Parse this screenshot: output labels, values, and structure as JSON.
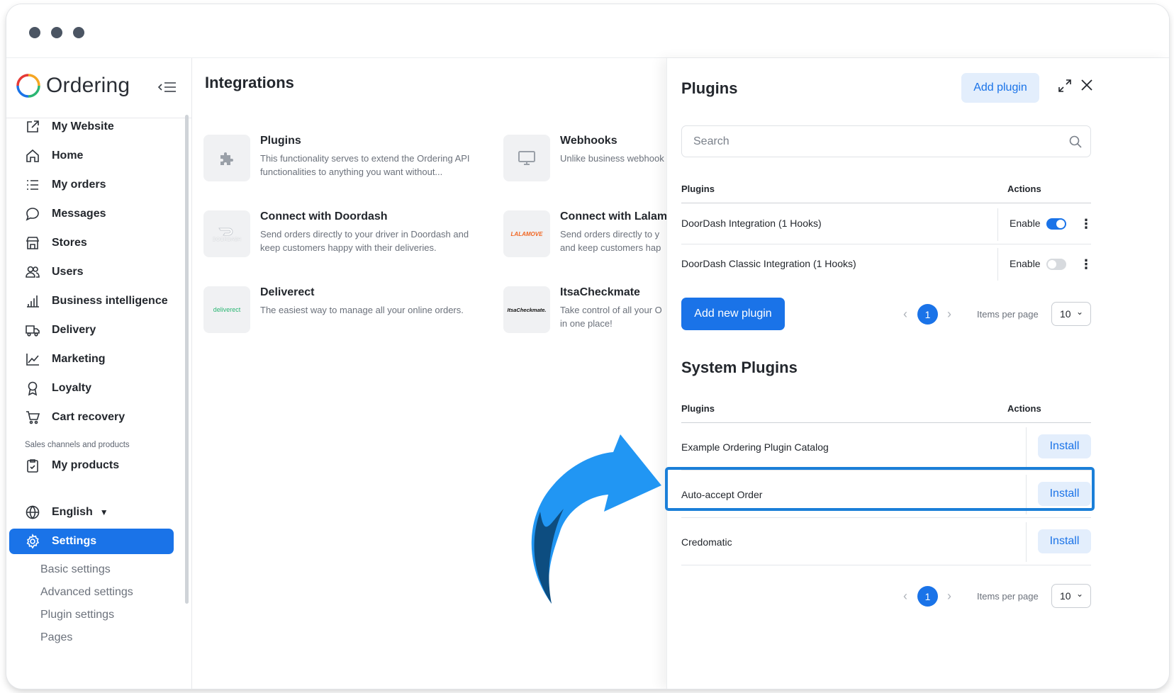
{
  "brand": {
    "name": "Ordering"
  },
  "sidebar": {
    "items": [
      {
        "label": "My Website",
        "icon": "external-link-icon"
      },
      {
        "label": "Home",
        "icon": "home-icon"
      },
      {
        "label": "My orders",
        "icon": "list-icon"
      },
      {
        "label": "Messages",
        "icon": "chat-icon"
      },
      {
        "label": "Stores",
        "icon": "store-icon"
      },
      {
        "label": "Users",
        "icon": "users-icon"
      },
      {
        "label": "Business intelligence",
        "icon": "bar-chart-icon"
      },
      {
        "label": "Delivery",
        "icon": "truck-icon"
      },
      {
        "label": "Marketing",
        "icon": "line-chart-icon"
      },
      {
        "label": "Loyalty",
        "icon": "award-icon"
      },
      {
        "label": "Cart recovery",
        "icon": "cart-icon"
      }
    ],
    "section_label": "Sales channels and products",
    "products_label": "My products",
    "language_label": "English",
    "settings_label": "Settings",
    "settings_sub": [
      "Basic settings",
      "Advanced settings",
      "Plugin settings",
      "Pages"
    ]
  },
  "main": {
    "title": "Integrations",
    "cards": [
      {
        "title": "Plugins",
        "desc": "This functionality serves to extend the Ordering API functionalities to anything you want without..."
      },
      {
        "title": "Webhooks",
        "desc": "Unlike business webhook listen to the events of the"
      },
      {
        "title": "Connect with Doordash",
        "desc": "Send orders directly to your driver in Doordash and keep customers happy with their deliveries.",
        "thumb_text": "DOORDASH"
      },
      {
        "title": "Connect with Lalamo",
        "desc": "Send orders directly to y and keep customers hap",
        "thumb_text": "LALAMOVE"
      },
      {
        "title": "Deliverect",
        "desc": "The easiest way to manage all your online orders.",
        "thumb_text": "deliverect"
      },
      {
        "title": "ItsaCheckmate",
        "desc": "Take control of all your O in one place!",
        "thumb_text": "ItsaCheckmate."
      }
    ]
  },
  "panel": {
    "title": "Plugins",
    "add_plugin": "Add plugin",
    "search_placeholder": "Search",
    "col_plugins": "Plugins",
    "col_actions": "Actions",
    "enable_label": "Enable",
    "rows": [
      {
        "name": "DoorDash Integration (1 Hooks)",
        "enabled": true
      },
      {
        "name": "DoorDash Classic Integration (1 Hooks)",
        "enabled": false
      }
    ],
    "add_new_plugin": "Add new plugin",
    "page": "1",
    "items_per_page_label": "Items per page",
    "items_per_page_value": "10",
    "system_title": "System Plugins",
    "install_label": "Install",
    "system_rows": [
      {
        "name": "Example Ordering Plugin Catalog"
      },
      {
        "name": "Auto-accept Order"
      },
      {
        "name": "Credomatic"
      }
    ]
  },
  "colors": {
    "primary": "#1a73e8",
    "highlight": "#1b7fd8",
    "arrow": "#2196f3",
    "arrow_dark": "#0d4d80"
  }
}
